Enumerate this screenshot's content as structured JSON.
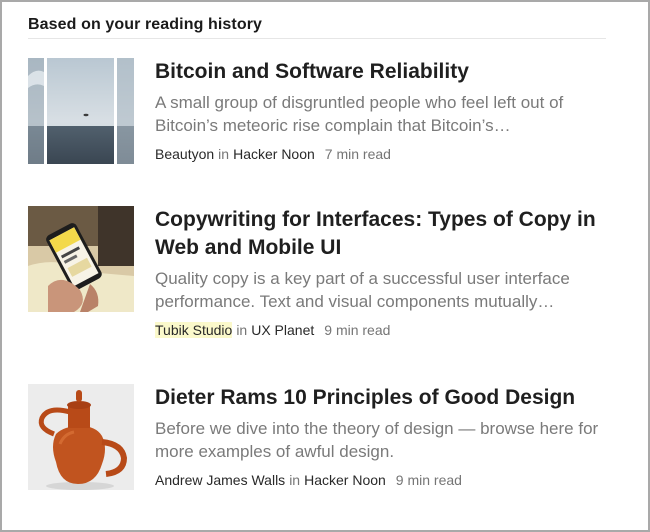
{
  "section": {
    "title": "Based on your reading history"
  },
  "articles": [
    {
      "title": "Bitcoin and Software Reliability",
      "description": "A small group of disgruntled people who feel left out of Bitcoin’s meteoric rise complain that Bitcoin’s…",
      "author": "Beautyon",
      "in_word": "in",
      "publication": "Hacker Noon",
      "read_time": "7 min read",
      "thumbnail_icon": "seascape-image"
    },
    {
      "title": "Copywriting for Interfaces: Types of Copy in Web and Mobile UI",
      "description": "Quality copy is a key part of a successful user interface performance. Text and visual components mutually…",
      "author": "Tubik Studio",
      "in_word": "in",
      "publication": "UX Planet",
      "read_time": "9 min read",
      "thumbnail_icon": "phone-in-hand-image"
    },
    {
      "title": "Dieter Rams 10 Principles of Good Design",
      "description": "Before we dive into the theory of design — browse here for more examples of awful design.",
      "author": "Andrew James Walls",
      "in_word": "in",
      "publication": "Hacker Noon",
      "read_time": "9 min read",
      "thumbnail_icon": "teapot-image"
    }
  ],
  "colors": {
    "title": "#1f1f1f",
    "description": "#7a7a7a",
    "meta": "#757575",
    "author_highlight": "#fbf9cb",
    "frame_border": "#a9a9a9"
  }
}
